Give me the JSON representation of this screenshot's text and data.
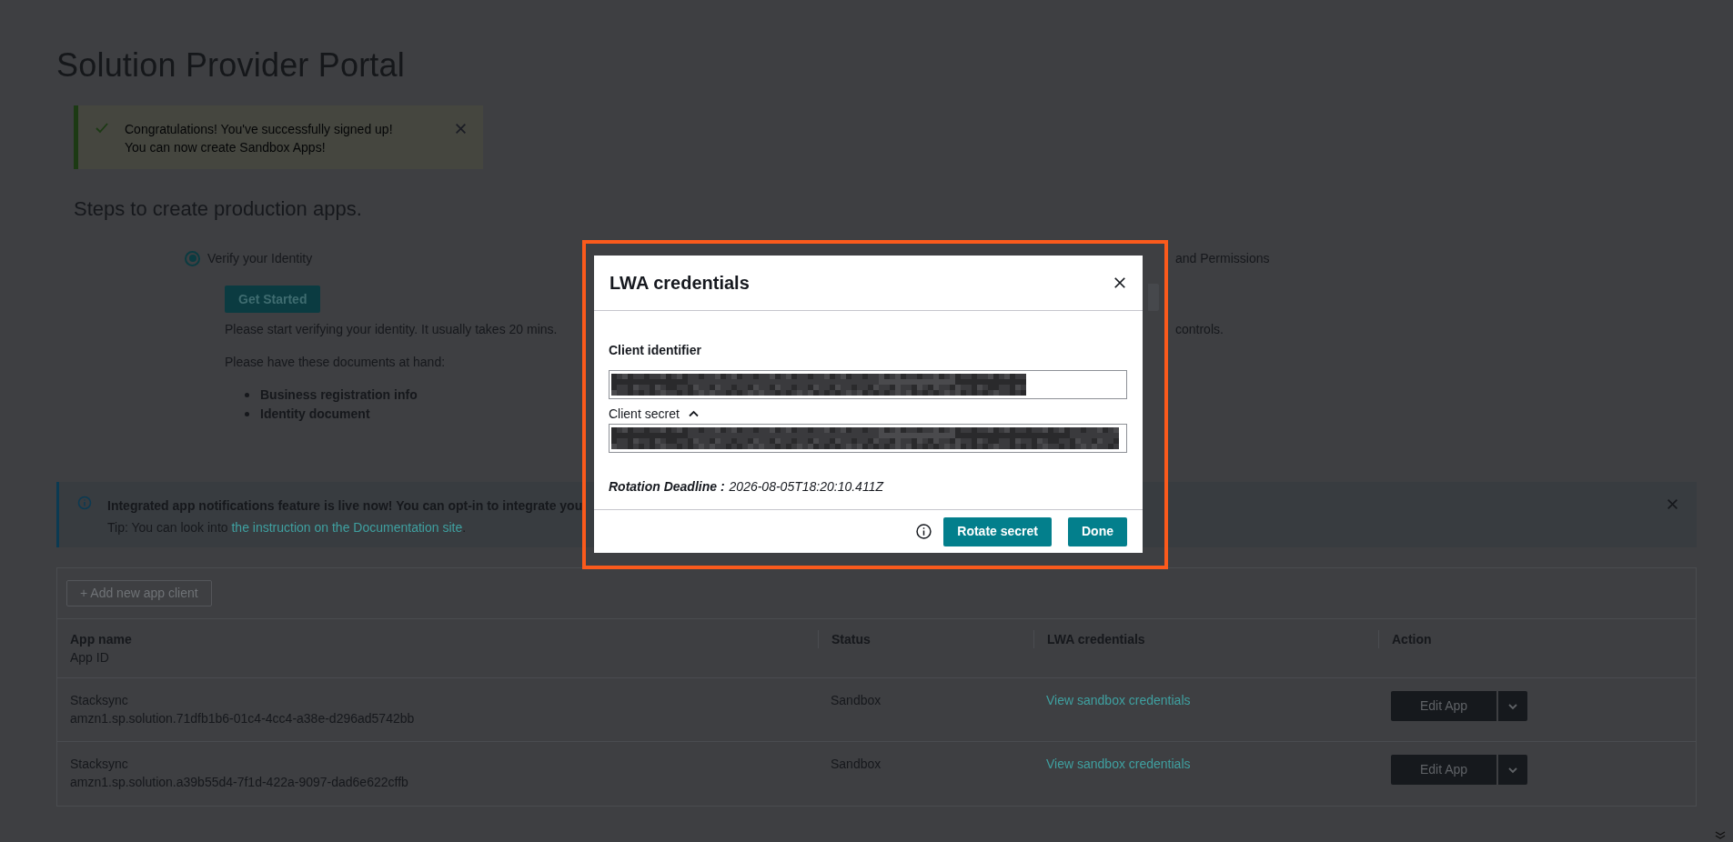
{
  "page": {
    "title": "Solution Provider Portal"
  },
  "flash": {
    "lines": [
      "Congratulations! You've successfully signed up!",
      "You can now create Sandbox Apps!"
    ]
  },
  "steps_heading": "Steps to create production apps.",
  "steps": [
    {
      "label": "Verify your Identity",
      "selected": true,
      "button": "Get Started",
      "description": "Please start verifying your identity. It usually takes 20 mins.",
      "documents_intro": "Please have these documents at hand:",
      "documents": [
        "Business registration info",
        "Identity document"
      ]
    },
    {
      "label": "and Permissions",
      "description": "controls."
    }
  ],
  "notice": {
    "title": "Integrated app notifications feature is live now! You can opt-in to integrate you",
    "tip": "Tip: You can look into",
    "link": "the instruction on the Documentation site",
    "tail": "."
  },
  "table": {
    "add_button": "+ Add new app client",
    "columns": [
      {
        "label": "App name",
        "sublabel": "App ID"
      },
      {
        "label": "Status"
      },
      {
        "label": "LWA credentials"
      },
      {
        "label": "Action"
      }
    ],
    "rows": [
      {
        "name": "Stacksync",
        "app_id": "amzn1.sp.solution.71dfb1b6-01c4-4cc4-a38e-d296ad5742bb",
        "status": "Sandbox",
        "credentials_link": "View sandbox credentials",
        "action": "Edit App"
      },
      {
        "name": "Stacksync",
        "app_id": "amzn1.sp.solution.a39b55d4-7f1d-422a-9097-dad6e622cffb",
        "status": "Sandbox",
        "credentials_link": "View sandbox credentials",
        "action": "Edit App"
      }
    ]
  },
  "modal": {
    "title": "LWA credentials",
    "fields": [
      {
        "label": "Client identifier",
        "kind": "heading"
      },
      {
        "label": "Client secret",
        "kind": "toggle",
        "expanded": true
      }
    ],
    "deadline_label": "Rotation Deadline :",
    "deadline": "2026-08-05T18:20:10.411Z",
    "buttons": [
      {
        "label": "Rotate secret"
      },
      {
        "label": "Done"
      }
    ]
  }
}
